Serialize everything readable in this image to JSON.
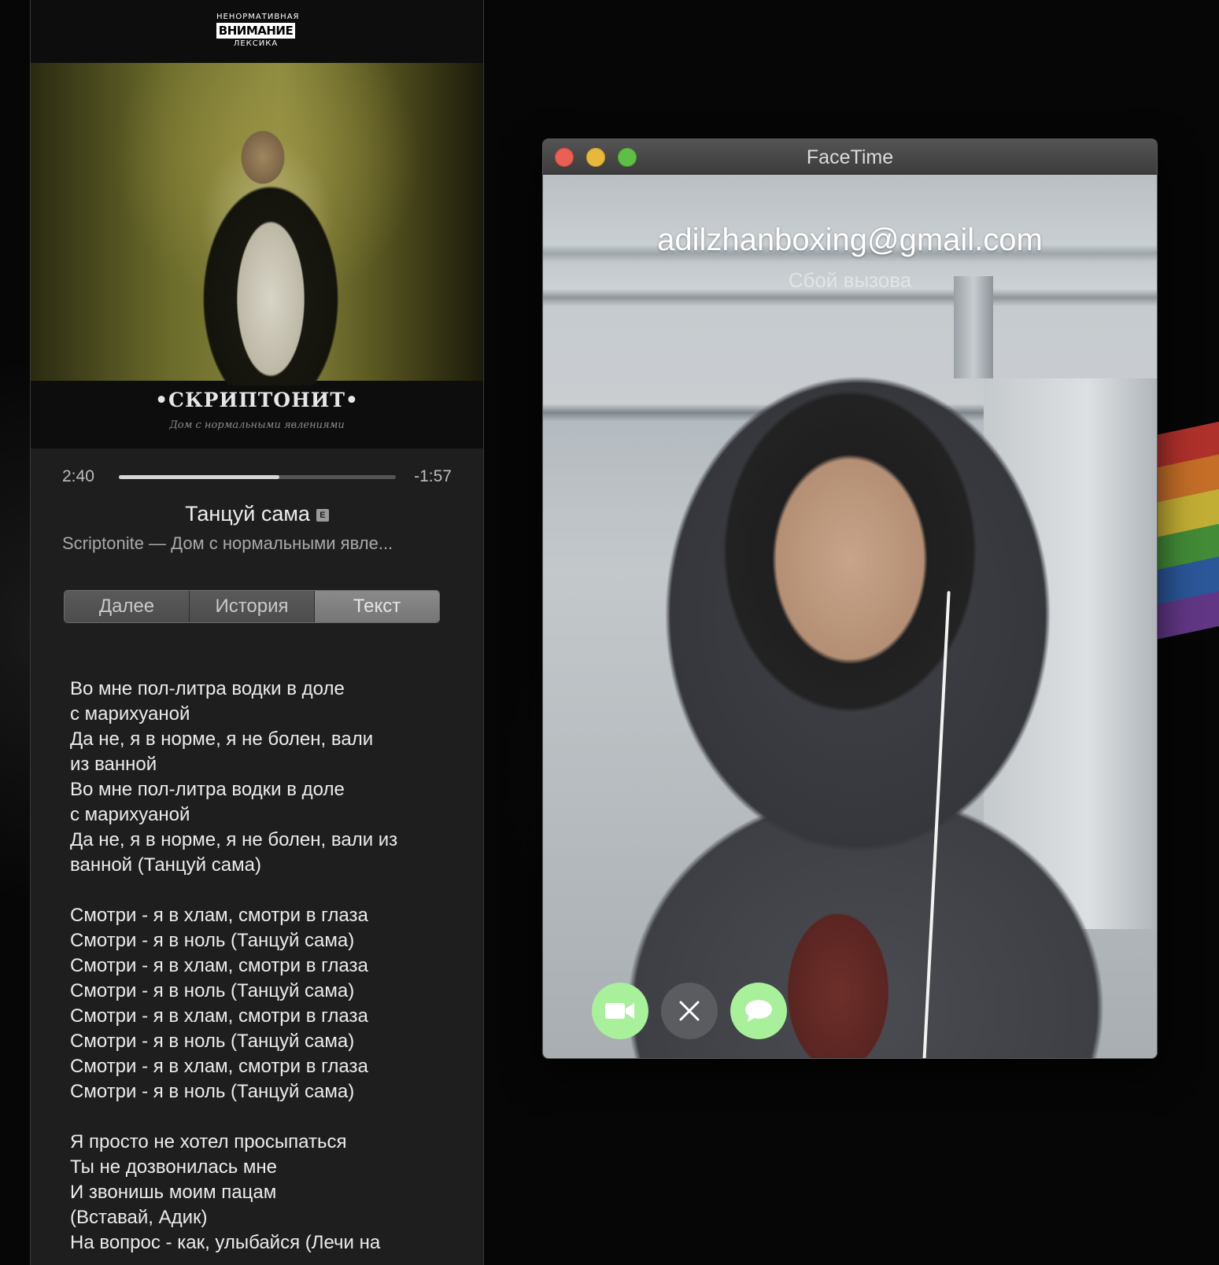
{
  "player": {
    "advisory": {
      "top": "НЕНОРМАТИВНАЯ",
      "middle": "ВНИМАНИЕ",
      "bottom": "ЛЕКСИКА"
    },
    "artwork_brand": "•СКРИПТОНИТ•",
    "artwork_subtitle": "Дом с нормальными явлениями",
    "elapsed": "2:40",
    "remaining": "-1:57",
    "progress": 0.58,
    "song_title": "Танцуй сама",
    "explicit_badge": "E",
    "artist_album": "Scriptonite — Дом с нормальными явле...",
    "tabs": [
      {
        "label": "Далее",
        "active": false
      },
      {
        "label": "История",
        "active": false
      },
      {
        "label": "Текст",
        "active": true
      }
    ],
    "lyrics": [
      "Во мне пол-литра водки в доле",
      "с марихуаной",
      "Да не, я в норме, я не болен, вали",
      "из ванной",
      "Во мне пол-литра водки в доле",
      "с марихуаной",
      "Да не, я в норме, я не болен, вали из",
      "ванной (Танцуй сама)",
      "",
      "Смотри - я в хлам, смотри в глаза",
      "Смотри - я в ноль (Танцуй сама)",
      "Смотри - я в хлам, смотри в глаза",
      "Смотри - я в ноль (Танцуй сама)",
      "Смотри - я в хлам, смотри в глаза",
      "Смотри - я в ноль (Танцуй сама)",
      "Смотри - я в хлам, смотри в глаза",
      "Смотри - я в ноль (Танцуй сама)",
      "",
      "Я просто не хотел просыпаться",
      "Ты не дозвонилась мне",
      "И звонишь моим пацам",
      "(Вставай, Адик)",
      "На вопрос - как, улыбайся (Лечи на"
    ]
  },
  "facetime": {
    "window_title": "FaceTime",
    "caller": "adilzhanboxing@gmail.com",
    "status": "Сбой вызова",
    "buttons": {
      "video": "video-camera-icon",
      "decline": "close-icon",
      "message": "message-bubble-icon"
    },
    "colors": {
      "accept_green": "#a9f09b",
      "decline_gray": "#5a5c5f",
      "close": "#ec5f55",
      "minimize": "#e8b83c",
      "zoom": "#5fbf45"
    }
  }
}
